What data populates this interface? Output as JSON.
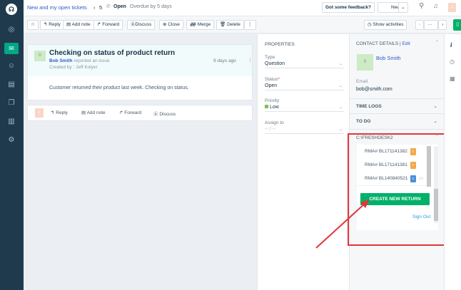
{
  "header": {
    "breadcrumb": "New and my open tickets",
    "ticket_number": "5",
    "status": "Open",
    "overdue": "Overdue by 5 days",
    "feedback": "Got some feedback?",
    "new_label": "New",
    "avatar": "J"
  },
  "toolbar": {
    "reply": "Reply",
    "add_note": "Add note",
    "forward": "Forward",
    "discuss": "Discuss",
    "close": "Close",
    "merge": "Merge",
    "delete": "Delete",
    "show_activities": "Show activities",
    "more": "···"
  },
  "ticket": {
    "avatar": "B",
    "title": "Checking on status of product return",
    "requester": "Bob Smith",
    "reported": "reported an issue",
    "created_by": "Created by : Jeff Kolyer",
    "time": "9 days ago",
    "body": "Customer returned their product last week. Checking on status."
  },
  "reply_bar": {
    "avatar": "J",
    "reply": "Reply",
    "add_note": "Add note",
    "forward": "Forward",
    "discuss": "Discuss"
  },
  "properties": {
    "title": "PROPERTIES",
    "type_label": "Type",
    "type_value": "Question",
    "status_label": "Status",
    "status_value": "Open",
    "priority_label": "Priority",
    "priority_value": "Low",
    "priority_color": "#7ec155",
    "assign_label": "Assign to",
    "assign_value": "-- / --"
  },
  "contact": {
    "title": "CONTACT DETAILS",
    "edit": "Edit",
    "avatar": "B",
    "name": "Bob Smith",
    "email_label": "Email",
    "email": "bob@smith.com"
  },
  "sections": {
    "time_logs": "TIME LOGS",
    "todo": "TO DO",
    "app": "C:\\FRESHDESK2"
  },
  "app": {
    "rmas": [
      {
        "id": "RMA# BL171141382",
        "badge": "r",
        "color": "#f5a948"
      },
      {
        "id": "RMA# BL171141381",
        "badge": "r",
        "color": "#f5a948"
      },
      {
        "id": "RMA# BL140840521",
        "badge": "c",
        "color": "#4a90d9"
      }
    ],
    "create": "CREATE NEW RETURN",
    "signout": "Sign Out"
  },
  "colors": {
    "accent": "#2c5cc5",
    "green": "#00b16a",
    "highlight": "#e43538"
  }
}
